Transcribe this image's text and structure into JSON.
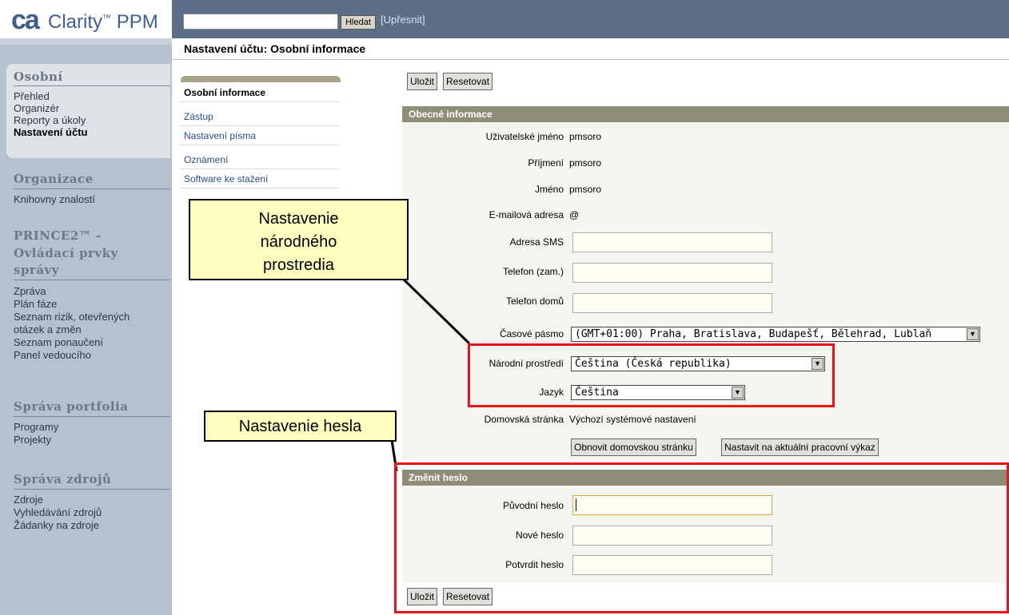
{
  "header": {
    "logo_ca": "ca",
    "logo_product": "Clarity",
    "logo_tm": "™",
    "logo_suffix": "PPM",
    "search_button": "Hledat",
    "refine_link": "[Upřesnit]"
  },
  "page_title": "Nastavení účtu: Osobní informace",
  "sidebar": {
    "sections": [
      {
        "title": "Osobní",
        "items": [
          "Přehled",
          "Organizér",
          "Reporty a úkoly",
          "Nastavení účtu"
        ]
      },
      {
        "title": "Organizace",
        "items": [
          "Knihovny znalostí"
        ]
      },
      {
        "title_lines": [
          "PRINCE2™ -",
          "Ovládací prvky",
          "správy"
        ],
        "items": [
          "Zpráva",
          "Plán fáze",
          "Seznam rizik, otevřených",
          "otázek a změn",
          "Seznam ponaučení",
          "Panel vedoucího"
        ]
      },
      {
        "title": "Správa portfolia",
        "items": [
          "Programy",
          "Projekty"
        ]
      },
      {
        "title": "Správa zdrojů",
        "items": [
          "Zdroje",
          "Vyhledávání zdrojů",
          "Žádanky na zdroje"
        ]
      }
    ]
  },
  "subnav": [
    "Osobní informace",
    "Zástup",
    "Nastavení písma",
    "Oznámení",
    "Software ke stažení"
  ],
  "buttons": {
    "save": "Uložit",
    "reset": "Resetovat",
    "reset_home": "Obnovit domovskou stránku",
    "set_current": "Nastavit na aktuální pracovní výkaz"
  },
  "general": {
    "title": "Obecné informace",
    "username_label": "Uživatelské jméno",
    "username": "pmsoro",
    "surname_label": "Příjmení",
    "surname": "pmsoro",
    "name_label": "Jméno",
    "name": "pmsoro",
    "email_label": "E-mailová adresa",
    "email": "@",
    "sms_label": "Adresa SMS",
    "phone_work_label": "Telefon (zam.)",
    "phone_home_label": "Telefon domů",
    "timezone_label": "Časové pásmo",
    "timezone": "(GMT+01:00) Praha, Bratislava, Budapešť, Bělehrad, Lublaň",
    "locale_label": "Národní prostředí",
    "locale": "Čeština (Česká republika)",
    "language_label": "Jazyk",
    "language": "Čeština",
    "homepage_label": "Domovská stránka",
    "homepage": "Výchozí systémové nastavení"
  },
  "password": {
    "title": "Změnit heslo",
    "old_label": "Původní heslo",
    "new_label": "Nové heslo",
    "confirm_label": "Potvrdit heslo"
  },
  "callouts": {
    "locale_lines": [
      "Nastavenie",
      "národného",
      "prostredia"
    ],
    "password": "Nastavenie hesla"
  },
  "colors": {
    "sidebar": "#b7c1ce",
    "topbar": "#5c6e86",
    "section_bar": "#8e8d78",
    "callout_bg": "#ffffc0",
    "highlight": "#e8141c"
  }
}
